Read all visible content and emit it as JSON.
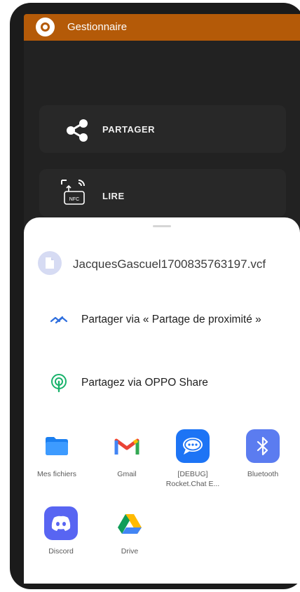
{
  "app": {
    "title": "Gestionnaire",
    "bar_color": "#b45a08"
  },
  "cards": {
    "share_label": "PARTAGER",
    "read_label": "LIRE",
    "nfc_tag": "NFC"
  },
  "sheet": {
    "file_name": "JacquesGascuel1700835763197.vcf",
    "options": [
      {
        "label": "Partager via « Partage de proximité »",
        "icon": "nearby-share-icon"
      },
      {
        "label": "Partagez via OPPO Share",
        "icon": "oppo-share-icon"
      }
    ],
    "apps": [
      {
        "label": "Mes fichiers",
        "icon": "folder-icon"
      },
      {
        "label": "Gmail",
        "icon": "gmail-icon"
      },
      {
        "label": "[DEBUG] Rocket.Chat E...",
        "icon": "rocket-chat-icon"
      },
      {
        "label": "Bluetooth",
        "icon": "bluetooth-icon"
      },
      {
        "label": "Discord",
        "icon": "discord-icon"
      },
      {
        "label": "Drive",
        "icon": "drive-icon"
      }
    ]
  },
  "colors": {
    "accent_blue": "#2f6fde",
    "oppo_green": "#19b26b",
    "discord": "#5865f2",
    "bluetooth": "#5b7cf0"
  }
}
